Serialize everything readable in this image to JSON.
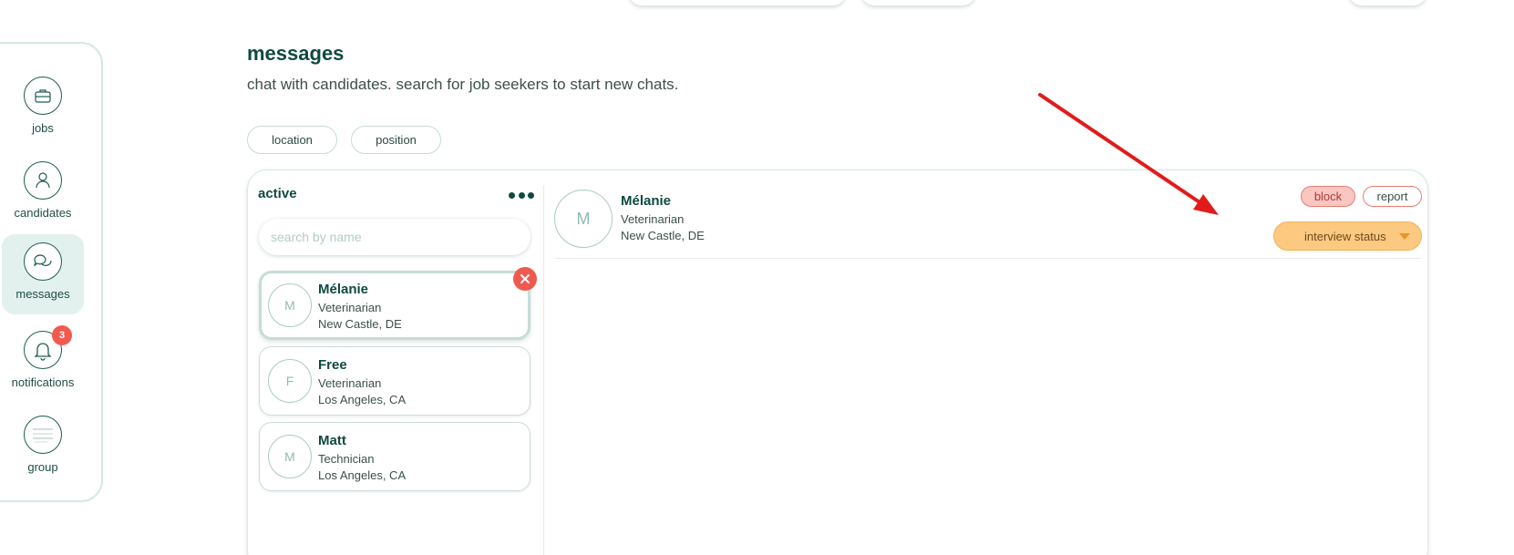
{
  "sidebar": {
    "items": [
      {
        "label": "jobs",
        "icon": "briefcase-icon"
      },
      {
        "label": "candidates",
        "icon": "person-icon"
      },
      {
        "label": "messages",
        "icon": "chat-bubbles-icon",
        "active": true
      },
      {
        "label": "notifications",
        "icon": "bell-icon",
        "badge": "3"
      },
      {
        "label": "group",
        "icon": "group-avatar-icon"
      }
    ]
  },
  "header": {
    "title": "messages",
    "subtitle": "chat with candidates. search for job seekers to start new chats."
  },
  "filters": [
    "location",
    "position"
  ],
  "chat_list": {
    "title": "active",
    "search_placeholder": "search by name",
    "items": [
      {
        "initial": "M",
        "name": "Mélanie",
        "role": "Veterinarian",
        "location": "New Castle, DE",
        "selected": true
      },
      {
        "initial": "F",
        "name": "Free",
        "role": "Veterinarian",
        "location": "Los Angeles, CA"
      },
      {
        "initial": "M",
        "name": "Matt",
        "role": "Technician",
        "location": "Los Angeles, CA"
      }
    ]
  },
  "conversation": {
    "initial": "M",
    "name": "Mélanie",
    "role": "Veterinarian",
    "location": "New Castle, DE",
    "block_label": "block",
    "report_label": "report",
    "status_label": "interview status"
  },
  "colors": {
    "primary": "#0e4a40",
    "active_bg": "#e3f1ee",
    "badge": "#f05a4f",
    "status_bg": "#fcc980",
    "block_bg": "#f9c6c2",
    "annotation_arrow": "#e11b1b"
  }
}
